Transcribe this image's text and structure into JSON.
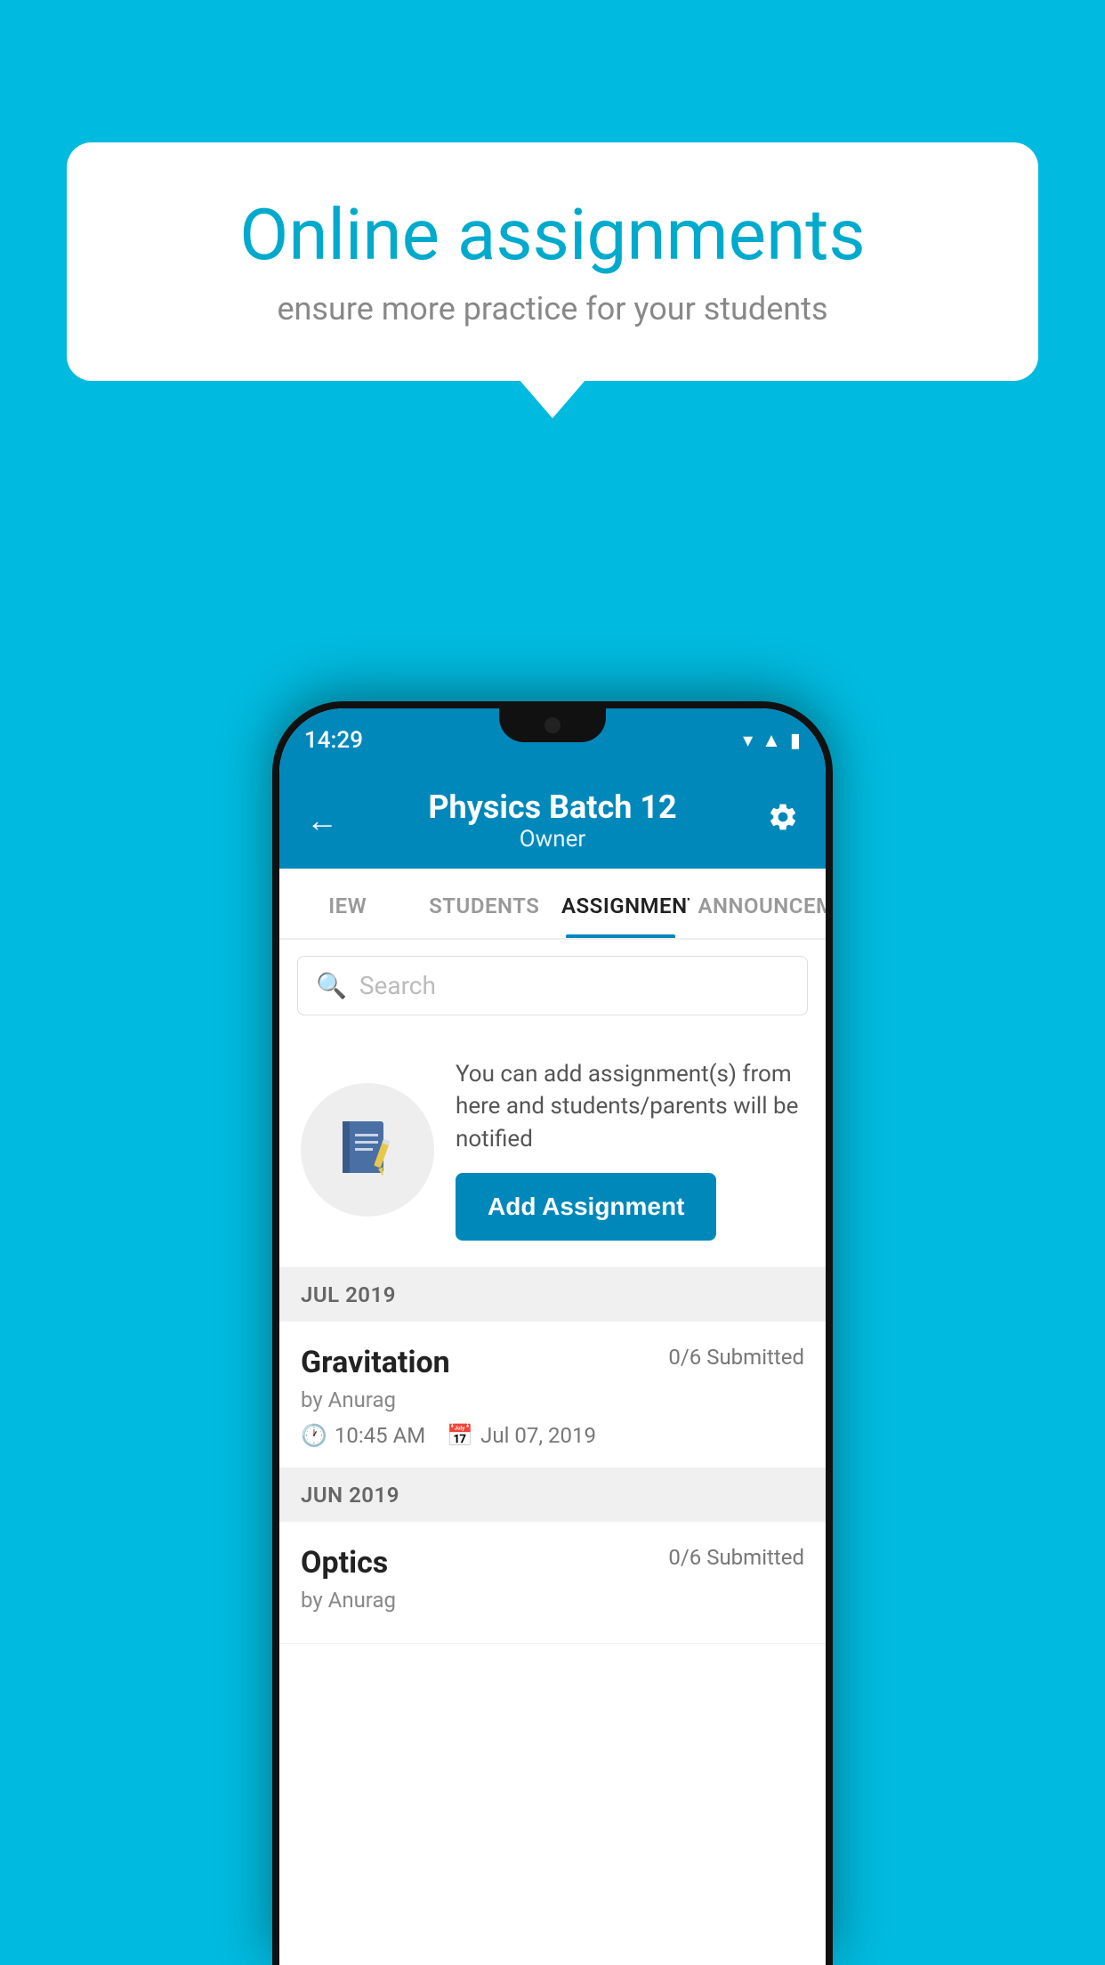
{
  "background_color": "#00BADF",
  "speech_bubble": {
    "title": "Online assignments",
    "subtitle": "ensure more practice for your students"
  },
  "phone": {
    "status_bar": {
      "time": "14:29",
      "icons": [
        "wifi",
        "signal",
        "battery"
      ]
    },
    "header": {
      "title": "Physics Batch 12",
      "subtitle": "Owner",
      "back_label": "←",
      "settings_label": "⚙"
    },
    "tabs": [
      {
        "label": "IEW",
        "active": false
      },
      {
        "label": "STUDENTS",
        "active": false
      },
      {
        "label": "ASSIGNMENTS",
        "active": true
      },
      {
        "label": "ANNOUNCEM…",
        "active": false
      }
    ],
    "search": {
      "placeholder": "Search"
    },
    "promo": {
      "description": "You can add assignment(s) from here and students/parents will be notified",
      "button_label": "Add Assignment"
    },
    "sections": [
      {
        "month_label": "JUL 2019",
        "assignments": [
          {
            "name": "Gravitation",
            "submitted": "0/6 Submitted",
            "by": "by Anurag",
            "time": "10:45 AM",
            "date": "Jul 07, 2019"
          }
        ]
      },
      {
        "month_label": "JUN 2019",
        "assignments": [
          {
            "name": "Optics",
            "submitted": "0/6 Submitted",
            "by": "by Anurag",
            "time": "",
            "date": ""
          }
        ]
      }
    ]
  }
}
